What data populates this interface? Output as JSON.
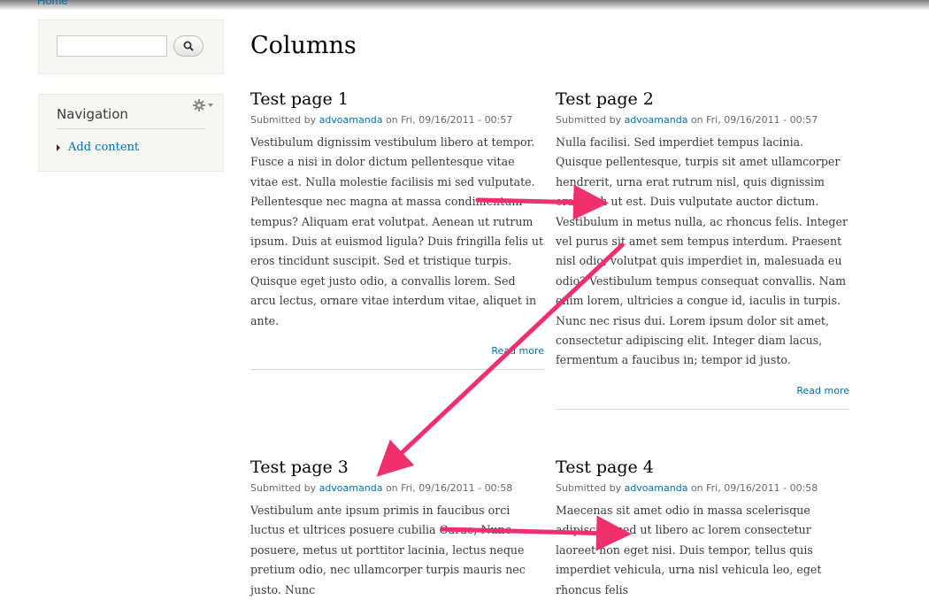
{
  "breadcrumb": {
    "home": "Home"
  },
  "search": {
    "value": "",
    "button_icon": "search-icon"
  },
  "navigation": {
    "title": "Navigation",
    "config_icon": "gear-icon",
    "items": [
      {
        "label": "Add content"
      }
    ]
  },
  "page": {
    "title": "Columns"
  },
  "nodes": [
    {
      "title": "Test page 1",
      "submitted_prefix": "Submitted by",
      "author": "advoamanda",
      "date": "on Fri, 09/16/2011 - 00:57",
      "body": "Vestibulum dignissim vestibulum libero at tempor. Fusce a nisi in dolor dictum pellentesque vitae vitae est. Nulla molestie facilisis mi sed vulputate. Pellentesque nec magna at massa condimentum tempus? Aliquam erat volutpat. Aenean ut rutrum ipsum. Duis at euismod ligula? Duis fringilla felis ut eros tincidunt suscipit. Sed et tristique turpis. Quisque eget justo odio, a convallis lorem. Sed arcu lectus, ornare vitae interdum vitae, aliquet in ante.",
      "read_more": "Read more"
    },
    {
      "title": "Test page 2",
      "submitted_prefix": "Submitted by",
      "author": "advoamanda",
      "date": "on Fri, 09/16/2011 - 00:57",
      "body": "Nulla facilisi. Sed imperdiet tempus lacinia. Quisque pellentesque, turpis sit amet ullamcorper hendrerit, urna erat rutrum nisl, quis dignissim erat nibh ut est. Duis vulputate auctor dictum. Vestibulum in metus nulla, ac rhoncus felis. Integer vel purus sit amet sem tempus interdum. Praesent nisl odio, volutpat quis imperdiet in, malesuada eu odio? Vestibulum tempus consequat convallis. Nam enim lorem, ultricies a congue id, iaculis in turpis. Nunc nec risus dui. Lorem ipsum dolor sit amet, consectetur adipiscing elit. Integer diam lacus, fermentum a faucibus in; tempor id justo.",
      "read_more": "Read more"
    },
    {
      "title": "Test page 3",
      "submitted_prefix": "Submitted by",
      "author": "advoamanda",
      "date": "on Fri, 09/16/2011 - 00:58",
      "body": "Vestibulum ante ipsum primis in faucibus orci luctus et ultrices posuere cubilia Curae; Nunc posuere, metus ut porttitor lacinia, lectus neque pretium odio, nec ullamcorper turpis mauris nec justo. Nunc"
    },
    {
      "title": "Test page 4",
      "submitted_prefix": "Submitted by",
      "author": "advoamanda",
      "date": "on Fri, 09/16/2011 - 00:58",
      "body": "Maecenas sit amet odio in massa scelerisque adipiscing sed ut libero ac lorem consectetur laoreet non eget nisi. Duis tempor, tellus quis imperdiet vehicula, urna nisl vehicula leo, eget rhoncus felis"
    }
  ],
  "colors": {
    "link": "#0071b3",
    "arrow": "#f0306e",
    "sidebar_bg": "#f6f6f2"
  }
}
